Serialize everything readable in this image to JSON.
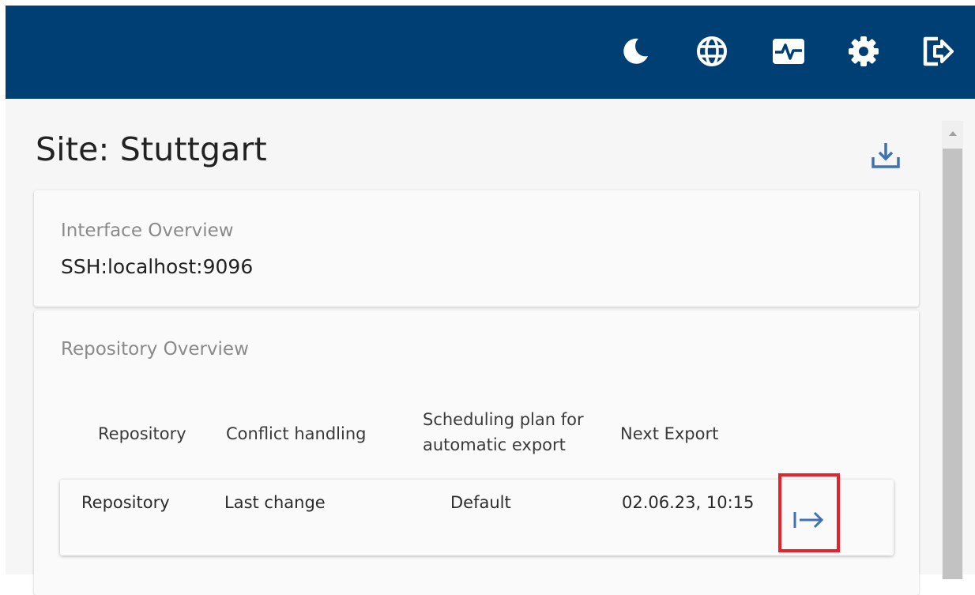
{
  "header": {
    "icons": [
      "moon-icon",
      "globe-icon",
      "activity-monitor-icon",
      "gear-icon",
      "logout-icon"
    ],
    "background": "#003f73"
  },
  "page": {
    "title": "Site: Stuttgart",
    "download_icon": "download-icon"
  },
  "interface_card": {
    "label": "Interface Overview",
    "value": "SSH:localhost:9096"
  },
  "repository_card": {
    "label": "Repository Overview",
    "columns": [
      "Repository",
      "Conflict handling",
      "Scheduling plan for automatic export",
      "Next Export"
    ],
    "rows": [
      {
        "repository": "Repository",
        "conflict_handling": "Last change",
        "scheduling_plan": "Default",
        "next_export": "02.06.23, 10:15",
        "action_icon": "export-arrow-icon"
      }
    ]
  },
  "colors": {
    "accent": "#3f72b5",
    "highlight": "#e8212b"
  }
}
